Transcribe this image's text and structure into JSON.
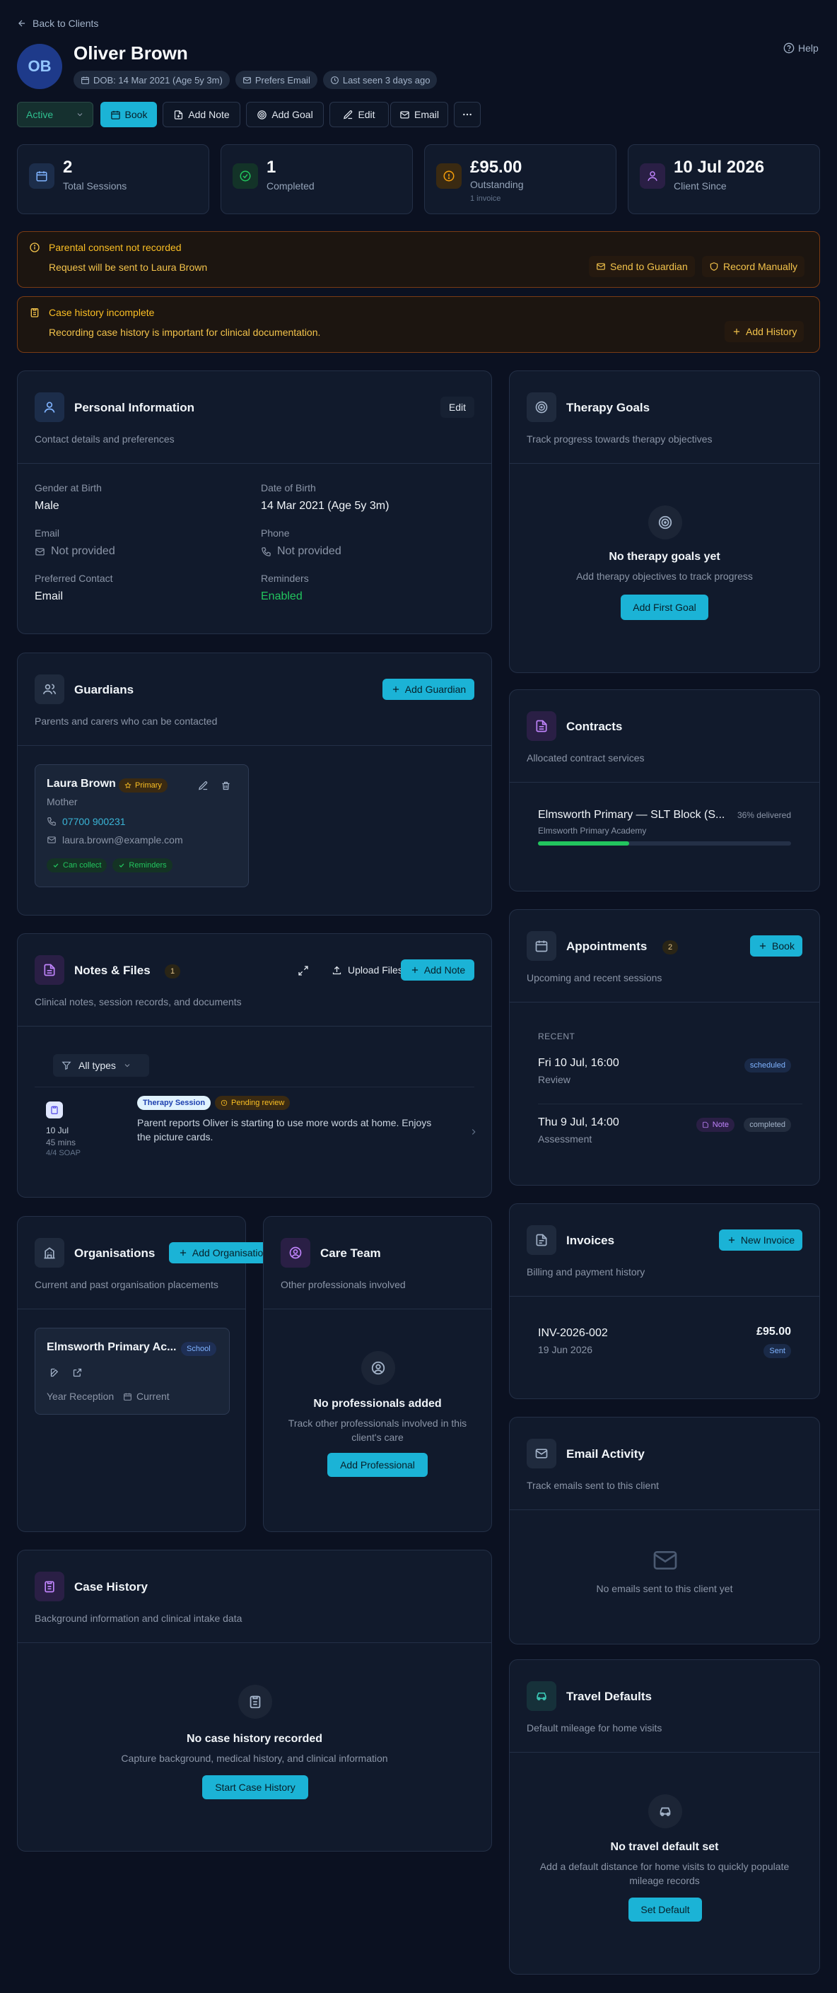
{
  "nav": {
    "back_label": "Back to Clients",
    "help_label": "Help"
  },
  "client": {
    "initials": "OB",
    "name": "Oliver Brown",
    "badges": {
      "dob": "DOB: 14 Mar 2021 (Age 5y 3m)",
      "contact_pref": "Prefers Email",
      "last_seen": "Last seen 3 days ago"
    }
  },
  "toolbar": {
    "status": "Active",
    "book": "Book",
    "add_note": "Add Note",
    "add_goal": "Add Goal",
    "edit": "Edit",
    "email": "Email"
  },
  "stats": [
    {
      "value": "2",
      "label": "Total Sessions",
      "sub": ""
    },
    {
      "value": "1",
      "label": "Completed",
      "sub": ""
    },
    {
      "value": "£95.00",
      "label": "Outstanding",
      "sub": "1 invoice"
    },
    {
      "value": "10 Jul 2026",
      "label": "Client Since",
      "sub": ""
    }
  ],
  "alerts": {
    "consent": {
      "title": "Parental consent not recorded",
      "text": "Request will be sent to Laura Brown",
      "send_btn": "Send to Guardian",
      "record_btn": "Record Manually"
    },
    "history": {
      "title": "Case history incomplete",
      "text": "Recording case history is important for clinical documentation.",
      "add_btn": "Add History"
    }
  },
  "personal": {
    "title": "Personal Information",
    "subtitle": "Contact details and preferences",
    "edit": "Edit",
    "gender_label": "Gender at Birth",
    "gender": "Male",
    "dob_label": "Date of Birth",
    "dob": "14 Mar 2021 (Age 5y 3m)",
    "email_label": "Email",
    "email": "Not provided",
    "phone_label": "Phone",
    "phone": "Not provided",
    "pref_label": "Preferred Contact",
    "pref": "Email",
    "reminders_label": "Reminders",
    "reminders": "Enabled"
  },
  "guardians": {
    "title": "Guardians",
    "subtitle": "Parents and carers who can be contacted",
    "add_btn": "Add Guardian",
    "item": {
      "name": "Laura Brown",
      "badge": "Primary",
      "relation": "Mother",
      "phone": "07700 900231",
      "email": "laura.brown@example.com",
      "tag1": "Can collect",
      "tag2": "Reminders"
    }
  },
  "notes": {
    "title": "Notes & Files",
    "count": "1",
    "subtitle": "Clinical notes, session records, and documents",
    "upload_btn": "Upload Files",
    "add_btn": "Add Note",
    "filter": "All types",
    "item": {
      "date": "10 Jul",
      "duration": "45 mins",
      "soap": "4/4 SOAP",
      "tag1": "Therapy Session",
      "tag2": "Pending review",
      "text1": "Parent reports Oliver is starting to use more words at home. Enjoys",
      "text2": "the picture cards."
    }
  },
  "organisations": {
    "title": "Organisations",
    "add_btn": "Add Organisation",
    "subtitle": "Current and past organisation placements",
    "item": {
      "name": "Elmsworth Primary Ac...",
      "badge": "School",
      "year": "Year Reception",
      "status": "Current"
    }
  },
  "care_team": {
    "title": "Care Team",
    "subtitle": "Other professionals involved",
    "empty_title": "No professionals added",
    "empty_desc": "Track other professionals involved in this client's care",
    "btn": "Add Professional"
  },
  "case_history": {
    "title": "Case History",
    "subtitle": "Background information and clinical intake data",
    "empty_title": "No case history recorded",
    "empty_desc": "Capture background, medical history, and clinical information",
    "btn": "Start Case History"
  },
  "goals": {
    "title": "Therapy Goals",
    "subtitle": "Track progress towards therapy objectives",
    "empty_title": "No therapy goals yet",
    "empty_desc": "Add therapy objectives to track progress",
    "btn": "Add First Goal"
  },
  "contracts": {
    "title": "Contracts",
    "subtitle": "Allocated contract services",
    "item": {
      "name": "Elmsworth Primary — SLT Block (S...",
      "delivered": "36% delivered",
      "org": "Elmsworth Primary Academy",
      "progress": 0.36
    }
  },
  "appointments": {
    "title": "Appointments",
    "count": "2",
    "subtitle": "Upcoming and recent sessions",
    "book_btn": "Book",
    "section": "RECENT",
    "items": [
      {
        "when": "Fri 10 Jul, 16:00",
        "type": "Review",
        "note": "",
        "status": "scheduled"
      },
      {
        "when": "Thu 9 Jul, 14:00",
        "type": "Assessment",
        "note": "Note",
        "status": "completed"
      }
    ]
  },
  "invoices": {
    "title": "Invoices",
    "subtitle": "Billing and payment history",
    "btn": "New Invoice",
    "item": {
      "number": "INV-2026-002",
      "date": "19 Jun 2026",
      "amount": "£95.00",
      "status": "Sent"
    }
  },
  "email_activity": {
    "title": "Email Activity",
    "subtitle": "Track emails sent to this client",
    "empty": "No emails sent to this client yet"
  },
  "travel": {
    "title": "Travel Defaults",
    "subtitle": "Default mileage for home visits",
    "empty_title": "No travel default set",
    "empty_desc": "Add a default distance for home visits to quickly populate mileage records",
    "btn": "Set Default"
  },
  "colors": {
    "accent": "#1bb3d6",
    "success": "#22c55e",
    "warning": "#fbbf24",
    "background": "#0b1121",
    "card": "#111a2c"
  }
}
